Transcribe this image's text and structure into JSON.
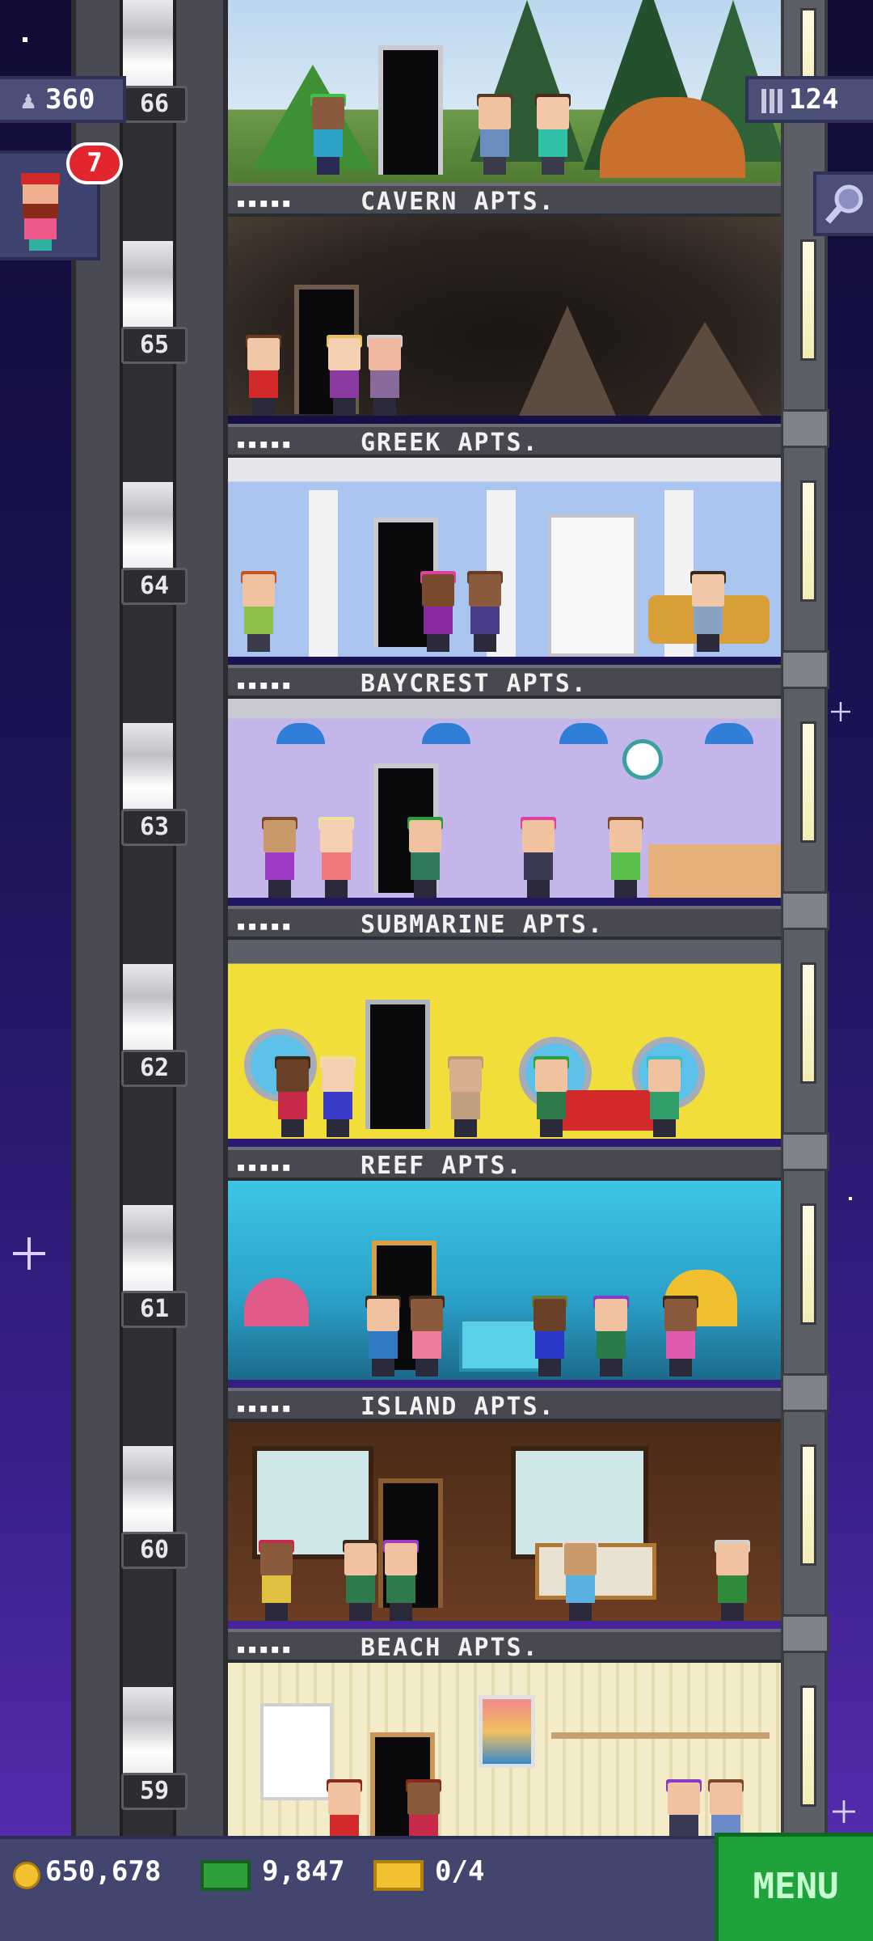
{
  "hud": {
    "population": "360",
    "bux": "124",
    "notification_count": "7"
  },
  "bottom_bar": {
    "coins": "650,678",
    "cash": "9,847",
    "tickets": "0/4",
    "menu_label": "MENU"
  },
  "floors": [
    {
      "number": "66",
      "name": ""
    },
    {
      "number": "65",
      "name": "CAVERN APTS."
    },
    {
      "number": "64",
      "name": "GREEK APTS."
    },
    {
      "number": "63",
      "name": "BAYCREST APTS."
    },
    {
      "number": "62",
      "name": "SUBMARINE APTS."
    },
    {
      "number": "61",
      "name": "REEF APTS."
    },
    {
      "number": "60",
      "name": "ISLAND APTS."
    },
    {
      "number": "59",
      "name": "BEACH APTS."
    }
  ],
  "sign_dots": "▪▪▪▪▪",
  "colors": {
    "sky_top": "#100c34",
    "sky_bottom": "#5a2fb6",
    "menu_green": "#1fa23c",
    "badge_red": "#e22630"
  }
}
